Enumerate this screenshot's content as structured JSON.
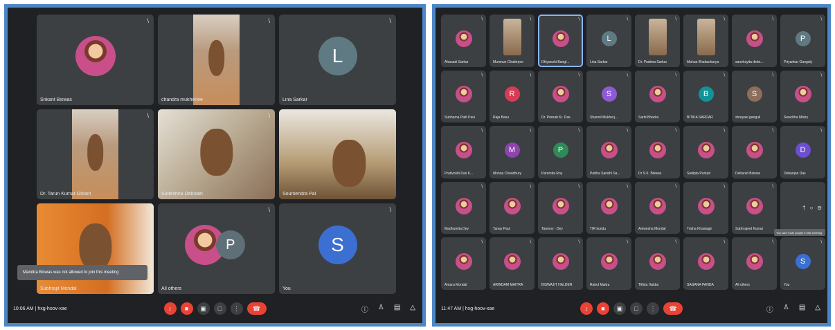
{
  "left_panel": {
    "tiles": [
      {
        "name": "Srikant Biswas",
        "kind": "photo"
      },
      {
        "name": "chandra mukherjee",
        "kind": "video1"
      },
      {
        "name": "Lina Sarkar",
        "kind": "letter",
        "letter": "L",
        "color": "#5f7a82"
      },
      {
        "name": "Dr. Tarun Kumar Ghosh",
        "kind": "video1b"
      },
      {
        "name": "Sudeshna Debnath",
        "kind": "video2"
      },
      {
        "name": "Soumendra Pal",
        "kind": "video3"
      },
      {
        "name": "Subhrajit Mondal",
        "kind": "video5"
      },
      {
        "name": "All others",
        "kind": "group",
        "letter": "P",
        "color": "#5f6f78"
      },
      {
        "name": "You",
        "kind": "letter",
        "letter": "S",
        "color": "#3b6fd1"
      }
    ],
    "toast": "Mandira Biswas was not allowed to join this meeting",
    "meeting_time": "10:06 AM",
    "meeting_code": "hxg-hoov-xae"
  },
  "right_panel": {
    "tiles": [
      {
        "name": "Ahanadi Sarkar",
        "kind": "photo"
      },
      {
        "name": "Munmun Chatterjee",
        "kind": "video"
      },
      {
        "name": "Dhiyanshi Bangl...",
        "kind": "photo"
      },
      {
        "name": "Lina Sarkar",
        "kind": "letter",
        "letter": "L",
        "color": "#5f7a82"
      },
      {
        "name": "Dr. Pratima Sarkar",
        "kind": "video"
      },
      {
        "name": "Mahua Bhattacharya",
        "kind": "video"
      },
      {
        "name": "sanchayita debn...",
        "kind": "photo"
      },
      {
        "name": "Priyankar Ganguly",
        "kind": "letter",
        "letter": "P",
        "color": "#5f7a82"
      },
      {
        "name": "Subhama Patit Paul",
        "kind": "photo"
      },
      {
        "name": "Raja Basu",
        "kind": "letter",
        "letter": "R",
        "color": "#d93b55"
      },
      {
        "name": "Dr. Pranab Kr. Das",
        "kind": "photo"
      },
      {
        "name": "Shanoli Mukherj...",
        "kind": "letter",
        "letter": "S",
        "color": "#8e5bd6"
      },
      {
        "name": "Sarbi Bhadra",
        "kind": "photo"
      },
      {
        "name": "BITIKA SARDAR",
        "kind": "letter",
        "letter": "B",
        "color": "#12939a"
      },
      {
        "name": "shreyasi ganguli",
        "kind": "letter",
        "letter": "S",
        "color": "#8c6e5a"
      },
      {
        "name": "Swachha Mistry",
        "kind": "photo"
      },
      {
        "name": "Prativoshi Das K...",
        "kind": "photo"
      },
      {
        "name": "Mohua Choudhury",
        "kind": "letter",
        "letter": "M",
        "color": "#8e44ad"
      },
      {
        "name": "Paromita Roy",
        "kind": "letter",
        "letter": "P",
        "color": "#2e8b57"
      },
      {
        "name": "Partha Sarathi Sa...",
        "kind": "photo"
      },
      {
        "name": "Dr S.K. Biswas",
        "kind": "photo"
      },
      {
        "name": "Sudipta Purkait",
        "kind": "photo"
      },
      {
        "name": "Debarati Biswas",
        "kind": "photo"
      },
      {
        "name": "Debanjan Das",
        "kind": "letter",
        "letter": "D",
        "color": "#6c4fd1"
      },
      {
        "name": "Madhumita Dey",
        "kind": "photo"
      },
      {
        "name": "Tanay Paul",
        "kind": "photo"
      },
      {
        "name": "Tanmoy - Dey",
        "kind": "photo"
      },
      {
        "name": "TIR kundu",
        "kind": "photo"
      },
      {
        "name": "Aniwesha Mondal",
        "kind": "photo"
      },
      {
        "name": "Trisha Khastagir",
        "kind": "photo"
      },
      {
        "name": "Subhrajeet Kumar",
        "kind": "photo"
      },
      {
        "name": "",
        "kind": "empty"
      },
      {
        "name": "Antara Mondal",
        "kind": "photo"
      },
      {
        "name": "ARINDAM MAITRA",
        "kind": "photo"
      },
      {
        "name": "BISWAJIT HALDER",
        "kind": "photo"
      },
      {
        "name": "Rahul Maitra",
        "kind": "photo"
      },
      {
        "name": "Tithita Haldar",
        "kind": "photo"
      },
      {
        "name": "SAGANA PANDA",
        "kind": "photo"
      },
      {
        "name": "All others",
        "kind": "photo"
      },
      {
        "name": "You",
        "kind": "letter",
        "letter": "S",
        "color": "#3b6fd1"
      }
    ],
    "tooltip": "You can't mute people in this meeting",
    "meeting_time": "11:47 AM",
    "meeting_code": "hxg-hoov-xae"
  },
  "separator": "|",
  "icons": {
    "mic": "mic-off-icon",
    "camera": "camera-off-icon",
    "captions": "captions-icon",
    "present": "present-icon",
    "more": "more-vert-icon",
    "end": "end-call-icon",
    "info": "info-icon",
    "people": "people-icon",
    "chat": "chat-icon",
    "activities": "activities-icon"
  },
  "glyphs": {
    "mic_off": "↕",
    "tile_mic_off": "∖",
    "camera_off": "■",
    "captions": "▣",
    "present": "□",
    "more": "⋮",
    "end": "☎",
    "info": "ⓘ",
    "people": "♙",
    "chat": "▤",
    "activities": "△",
    "pin": "†",
    "zoom": "○",
    "remove": "⊖"
  }
}
